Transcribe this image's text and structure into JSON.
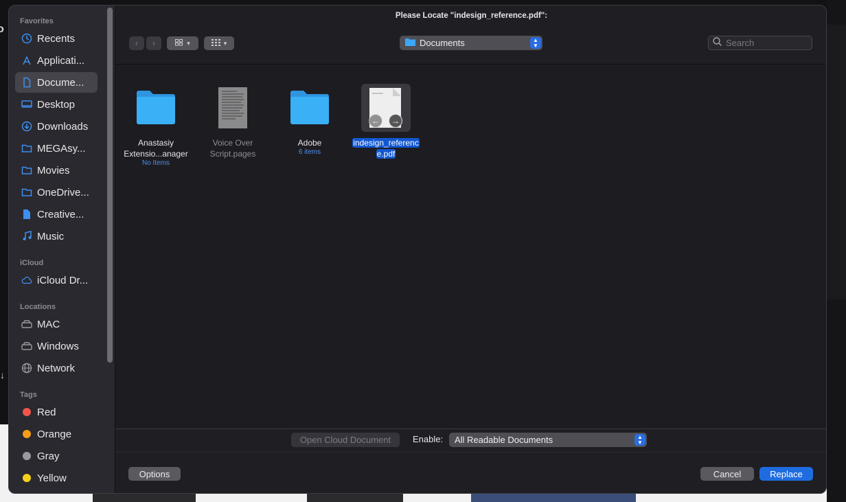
{
  "dialog": {
    "title": "Please Locate \"indesign_reference.pdf\":"
  },
  "background": {
    "left_text": "o",
    "left_arrow": "↓"
  },
  "sidebar": {
    "sections": {
      "favorites": "Favorites",
      "icloud": "iCloud",
      "locations": "Locations",
      "tags": "Tags"
    },
    "favorites": [
      {
        "label": "Recents",
        "icon": "clock-icon"
      },
      {
        "label": "Applicati...",
        "icon": "applications-icon"
      },
      {
        "label": "Docume...",
        "icon": "document-icon",
        "selected": true
      },
      {
        "label": "Desktop",
        "icon": "desktop-icon"
      },
      {
        "label": "Downloads",
        "icon": "download-icon"
      },
      {
        "label": "MEGAsy...",
        "icon": "folder-icon"
      },
      {
        "label": "Movies",
        "icon": "folder-icon"
      },
      {
        "label": "OneDrive...",
        "icon": "folder-icon"
      },
      {
        "label": "Creative...",
        "icon": "file-icon"
      },
      {
        "label": "Music",
        "icon": "music-icon"
      }
    ],
    "icloud": [
      {
        "label": "iCloud Dr...",
        "icon": "cloud-icon"
      }
    ],
    "locations": [
      {
        "label": "MAC",
        "icon": "drive-icon"
      },
      {
        "label": "Windows",
        "icon": "drive-icon"
      },
      {
        "label": "Network",
        "icon": "globe-icon"
      }
    ],
    "tags": [
      {
        "label": "Red",
        "color": "#f0564a"
      },
      {
        "label": "Orange",
        "color": "#f59e1a"
      },
      {
        "label": "Gray",
        "color": "#9a999e"
      },
      {
        "label": "Yellow",
        "color": "#f5d21a"
      }
    ]
  },
  "toolbar": {
    "path": "Documents",
    "search_placeholder": "Search"
  },
  "files": [
    {
      "name_line1": "Anastasiy",
      "name_line2": "Extensio...anager",
      "sub": "No Items",
      "type": "folder"
    },
    {
      "name_line1": "Voice Over",
      "name_line2": "Script.pages",
      "sub": "",
      "type": "pages",
      "dim": true
    },
    {
      "name_line1": "Adobe",
      "name_line2": "",
      "sub": "6 items",
      "type": "folder"
    },
    {
      "name_line1": "indesign_referenc",
      "name_line2": "e.pdf",
      "sub": "",
      "type": "pdf",
      "selected": true
    }
  ],
  "footer": {
    "cloud_button": "Open Cloud Document",
    "enable_label": "Enable:",
    "enable_value": "All Readable Documents",
    "options": "Options",
    "cancel": "Cancel",
    "replace": "Replace"
  },
  "colors": {
    "accent": "#1f6ce0",
    "folder": "#3da6f5",
    "selection": "#1257d1"
  }
}
